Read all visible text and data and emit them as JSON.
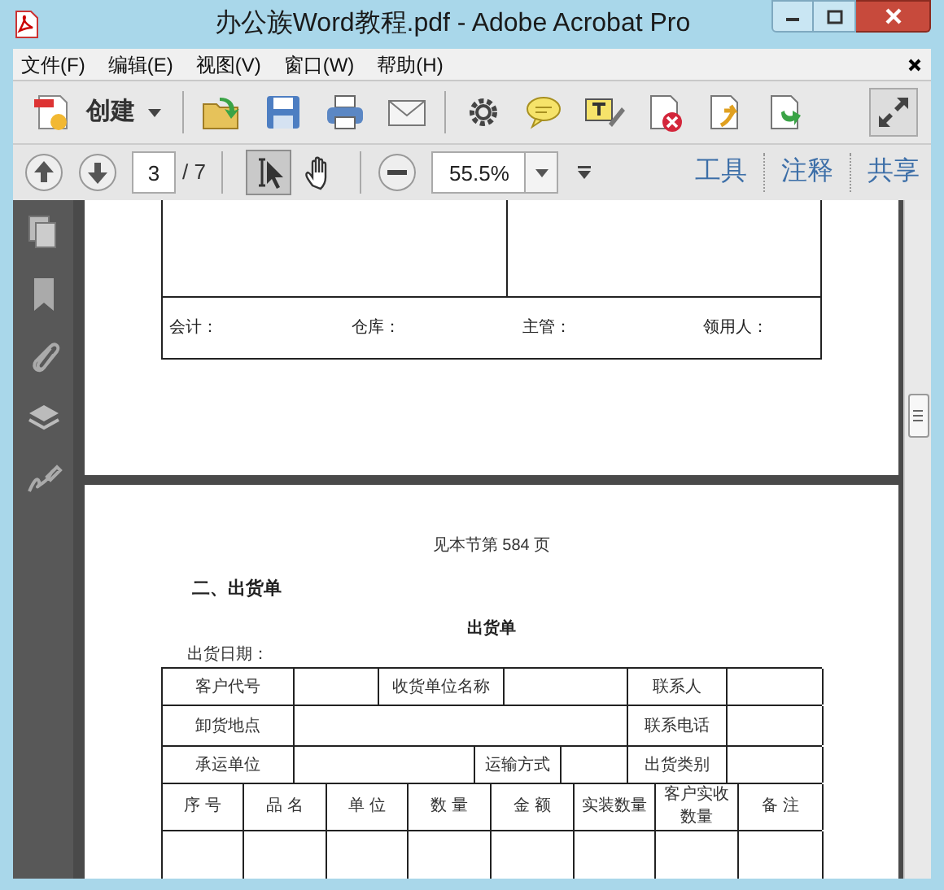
{
  "window": {
    "title": "办公族Word教程.pdf - Adobe Acrobat Pro"
  },
  "menu": [
    "文件(F)",
    "编辑(E)",
    "视图(V)",
    "窗口(W)",
    "帮助(H)"
  ],
  "toolbar": {
    "create_label": "创建"
  },
  "nav_bar": {
    "page": "3",
    "page_count": "/ 7",
    "zoom": "55.5%",
    "tools": [
      {
        "kind": "select",
        "selected": true
      },
      {
        "kind": "hand",
        "selected": false
      }
    ],
    "panels": [
      "工具",
      "注释",
      "共享"
    ]
  },
  "document": {
    "page_top": {
      "signatures": [
        "会计：",
        "仓库：",
        "主管：",
        "领用人："
      ]
    },
    "page_next": {
      "reference": "见本节第 584 页",
      "heading": "二、出货单",
      "form_title": "出货单",
      "date_label": "出货日期：",
      "form_rows": [
        [
          "客户代号",
          "收货单位名称",
          "联系人"
        ],
        [
          "卸货地点",
          "联系电话"
        ],
        [
          "承运单位",
          "运输方式",
          "出货类别"
        ]
      ],
      "item_columns": [
        "序 号",
        "品 名",
        "单 位",
        "数 量",
        "金 额",
        "实装数量",
        "客户实收数量",
        "备 注"
      ]
    }
  }
}
